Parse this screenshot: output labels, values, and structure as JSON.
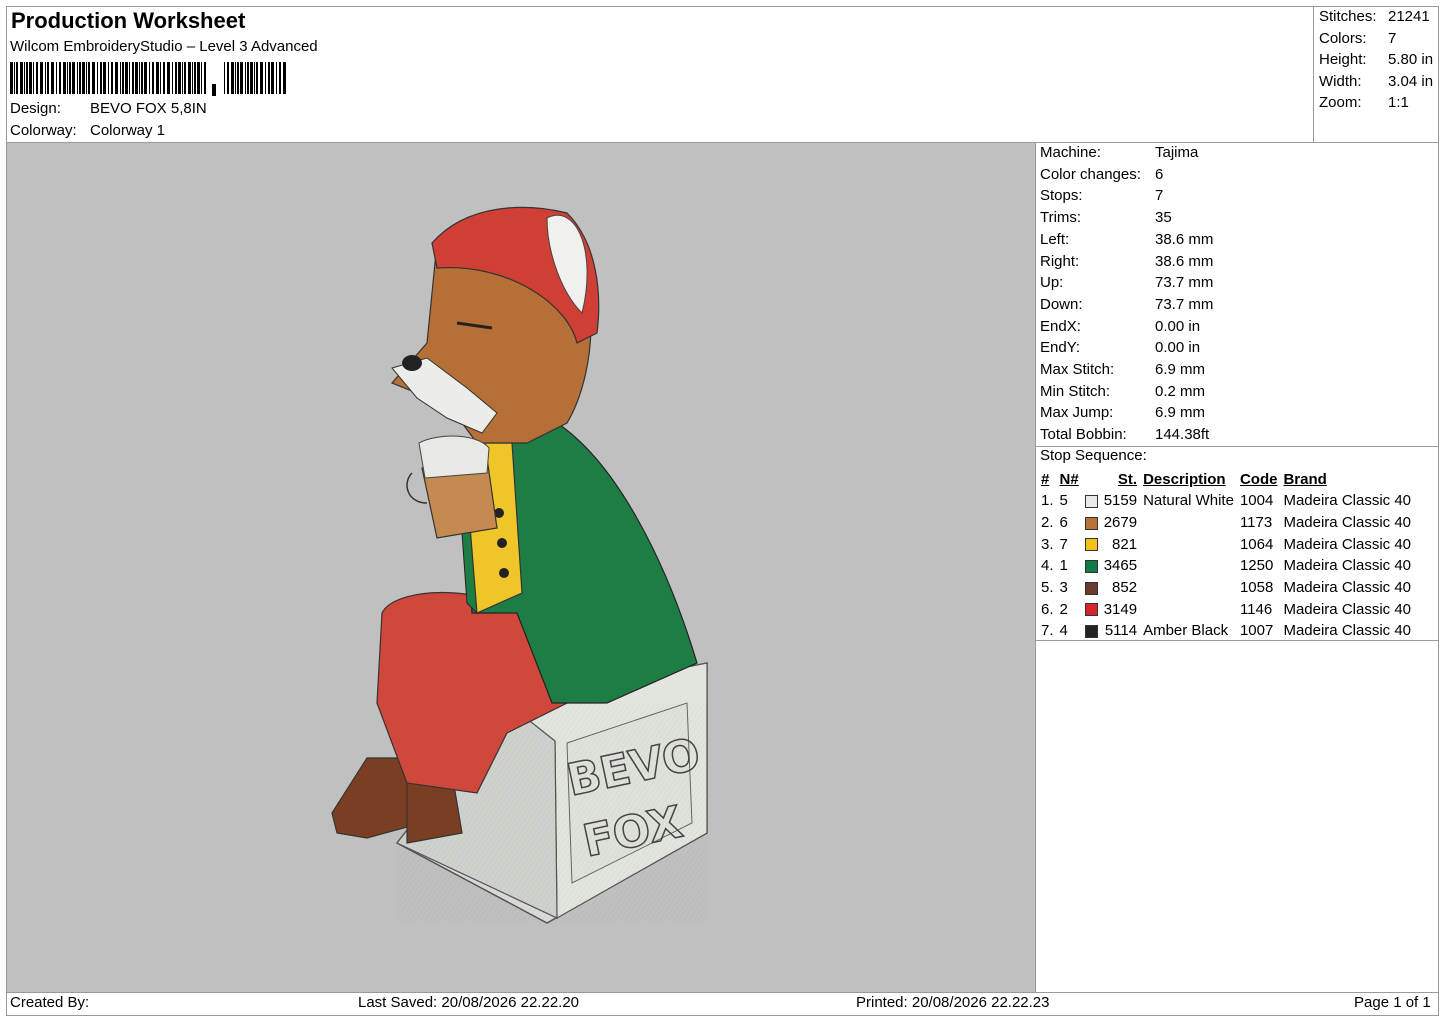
{
  "header": {
    "title": "Production Worksheet",
    "software": "Wilcom EmbroideryStudio – Level 3 Advanced",
    "design_label": "Design:",
    "design_value": "BEVO FOX 5,8IN",
    "colorway_label": "Colorway:",
    "colorway_value": "Colorway 1"
  },
  "stats": [
    {
      "k": "Stitches:",
      "v": "21241"
    },
    {
      "k": "Colors:",
      "v": "7"
    },
    {
      "k": "Height:",
      "v": "5.80 in"
    },
    {
      "k": "Width:",
      "v": "3.04 in"
    },
    {
      "k": "Zoom:",
      "v": "1:1"
    }
  ],
  "machine_info": [
    {
      "k": "Machine:",
      "v": "Tajima"
    },
    {
      "k": "Color changes:",
      "v": "6"
    },
    {
      "k": "Stops:",
      "v": "7"
    },
    {
      "k": "Trims:",
      "v": "35"
    },
    {
      "k": "Left:",
      "v": "38.6 mm"
    },
    {
      "k": "Right:",
      "v": "38.6 mm"
    },
    {
      "k": "Up:",
      "v": "73.7 mm"
    },
    {
      "k": "Down:",
      "v": "73.7 mm"
    },
    {
      "k": "EndX:",
      "v": "0.00 in"
    },
    {
      "k": "EndY:",
      "v": "0.00 in"
    },
    {
      "k": "Max Stitch:",
      "v": "6.9 mm"
    },
    {
      "k": "Min Stitch:",
      "v": "0.2 mm"
    },
    {
      "k": "Max Jump:",
      "v": "6.9 mm"
    },
    {
      "k": "Total Bobbin:",
      "v": "144.38ft"
    }
  ],
  "stop_sequence": {
    "label": "Stop Sequence:",
    "headers": [
      "#",
      "N#",
      "St.",
      "Description",
      "Code",
      "Brand"
    ],
    "rows": [
      {
        "num": "1.",
        "n": "5",
        "color": "#e9e9ea",
        "st": "5159",
        "desc": "Natural White",
        "code": "1004",
        "brand": "Madeira Classic 40"
      },
      {
        "num": "2.",
        "n": "6",
        "color": "#b8733a",
        "st": "2679",
        "desc": "",
        "code": "1173",
        "brand": "Madeira Classic 40"
      },
      {
        "num": "3.",
        "n": "7",
        "color": "#f2c21b",
        "st": "821",
        "desc": "",
        "code": "1064",
        "brand": "Madeira Classic 40"
      },
      {
        "num": "4.",
        "n": "1",
        "color": "#0f7a45",
        "st": "3465",
        "desc": "",
        "code": "1250",
        "brand": "Madeira Classic 40"
      },
      {
        "num": "5.",
        "n": "3",
        "color": "#6b3a2a",
        "st": "852",
        "desc": "",
        "code": "1058",
        "brand": "Madeira Classic 40"
      },
      {
        "num": "6.",
        "n": "2",
        "color": "#d7262b",
        "st": "3149",
        "desc": "",
        "code": "1146",
        "brand": "Madeira Classic 40"
      },
      {
        "num": "7.",
        "n": "4",
        "color": "#222222",
        "st": "5114",
        "desc": "Amber Black",
        "code": "1007",
        "brand": "Madeira Classic 40"
      }
    ]
  },
  "box_text": {
    "line1": "BEVO",
    "line2": "FOX"
  },
  "footer": {
    "created_by": "Created By:",
    "last_saved": "Last Saved: 20/08/2026 22.22.20",
    "printed": "Printed: 20/08/2026 22.22.23",
    "page": "Page 1 of 1"
  }
}
